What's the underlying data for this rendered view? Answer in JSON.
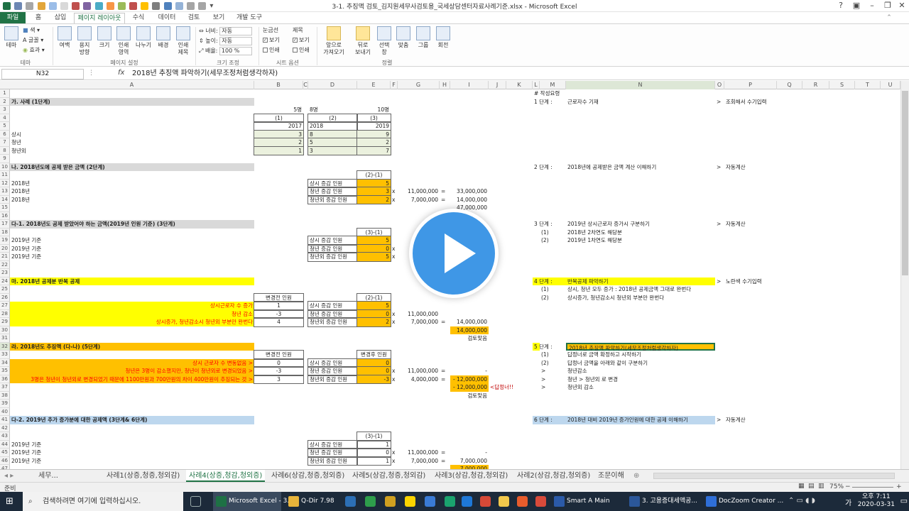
{
  "window": {
    "title": "3-1. 추징액 검토_김지원세무사검토용_국세상담센터자료사례기준.xlsx - Microsoft Excel"
  },
  "tabs": [
    {
      "label": "파일"
    },
    {
      "label": "홈"
    },
    {
      "label": "삽입"
    },
    {
      "label": "페이지 레이아웃"
    },
    {
      "label": "수식"
    },
    {
      "label": "데이터"
    },
    {
      "label": "검토"
    },
    {
      "label": "보기"
    },
    {
      "label": "개발 도구"
    }
  ],
  "ribbon": {
    "theme_group": {
      "theme": "테마",
      "colors": "색",
      "fonts": "글꼴",
      "effects": "효과",
      "label": "테마"
    },
    "page_setup": {
      "margins": "여백",
      "orientation": "용지\n방향",
      "size": "크기",
      "print_area": "인쇄\n영역",
      "breaks": "나누기",
      "background": "배경",
      "print_titles": "인쇄\n제목",
      "label": "페이지 설정"
    },
    "scale": {
      "width_label": "너비:",
      "width_value": "자동",
      "height_label": "높이:",
      "height_value": "자동",
      "scale_label": "배율:",
      "scale_value": "100 %",
      "label": "크기 조정"
    },
    "sheet_options": {
      "gridlines": "눈금선",
      "headings": "제목",
      "view1": "보기",
      "print1": "인쇄",
      "view2": "보기",
      "print2": "인쇄",
      "label": "시트 옵션"
    },
    "arrange": {
      "bring_forward": "앞으로\n가져오기",
      "send_backward": "뒤로\n보내기",
      "selection_pane": "선택\n창",
      "align": "맞춤",
      "group": "그룹",
      "rotate": "회전",
      "label": "정렬"
    }
  },
  "formula_bar": {
    "name_box": "N32",
    "fx": "fx",
    "content": "2018년 추징액 파악하기(세무조정처럼생각하자)"
  },
  "columns": [
    "A",
    "B",
    "C",
    "D",
    "E",
    "F",
    "G",
    "H",
    "I",
    "J",
    "K",
    "L",
    "M",
    "N",
    "O",
    "P",
    "Q",
    "R",
    "S",
    "T",
    "U"
  ],
  "rows": [
    "1",
    "2",
    "3",
    "4",
    "5",
    "6",
    "7",
    "8",
    "9",
    "10",
    "11",
    "12",
    "13",
    "14",
    "15",
    "16",
    "17",
    "18",
    "19",
    "20",
    "21",
    "22",
    "23",
    "24",
    "25",
    "26",
    "27",
    "28",
    "29",
    "30",
    "31",
    "32",
    "33",
    "34",
    "35",
    "36",
    "37",
    "38",
    "39",
    "40",
    "41",
    "42",
    "43",
    "44",
    "45",
    "46",
    "47"
  ],
  "cells": {
    "A2": "가. 사례 (1단계)",
    "B3": "5명",
    "D3": "8명",
    "E3": "10명",
    "B4": "(1)",
    "D4": "(2)",
    "E4": "(3)",
    "B5": "2017",
    "D5": "2018",
    "E5": "2019",
    "A6": "상시",
    "B6": "3",
    "D6": "8",
    "E6": "9",
    "A7": "청년",
    "B7": "2",
    "D7": "5",
    "E7": "2",
    "A8": "청년외",
    "B8": "1",
    "D8": "3",
    "E8": "7",
    "A10": "나. 2018년도에 공제 받은 금액 (2단계)",
    "E11": "(2)-(1)",
    "A12": "2018년",
    "D12": "상시 증감 인원",
    "E12": "5",
    "A13": "2018년",
    "D13": "청년 증감 인원",
    "E13": "3",
    "F13": "x",
    "G13": "11,000,000",
    "H13": "=",
    "I13": "33,000,000",
    "A14": "2018년",
    "D14": "청년외 증감 인원",
    "E14": "2",
    "F14": "x",
    "G14": "7,000,000",
    "H14": "=",
    "I14": "14,000,000",
    "I15": "47,000,000",
    "A17": "다-1. 2018년도 공제 받았어야 하는 금액(2019년 인원 기준) (3단계)",
    "E18": "(3)-(1)",
    "A19": "2019년 기준",
    "D19": "상시 증감 인원",
    "E19": "5",
    "A20": "2019년 기준",
    "D20": "청년 증감 인원",
    "E20": "0",
    "F20": "x",
    "A21": "2019년 기준",
    "D21": "청년외 증감 인원",
    "E21": "5",
    "F21": "x",
    "A24": "마. 2018년 공제분 반복 공제",
    "B26": "변경전 인원",
    "E26": "(2)-(1)",
    "A27": "상시근로자 수 증가",
    "B27": "1",
    "D27": "상시 증감 인원",
    "E27": "5",
    "A28": "청년 감소",
    "B28": "-3",
    "D28": "청년 증감 인원",
    "E28": "0",
    "F28": "x",
    "G28": "11,000,000",
    "A29": "상시증가, 청년감소시 청년외 부분만 완번다",
    "B29": "4",
    "D29": "청년외 증감 인원",
    "E29": "2",
    "F29": "x",
    "G29": "7,000,000",
    "H29": "=",
    "I29": "14,000,000",
    "I30": "14,000,000",
    "I31": "검토맞음",
    "A32": "라. 2018년도 추징액 (다-나) (5단계)",
    "B33": "변경전 인원",
    "E33": "변경후 인원",
    "A34": "상시 근로자 수 변동없음 >",
    "B34": "0",
    "D34": "상시 증감 인원",
    "E34": "0",
    "A35": "청년은 3명이 감소했지만, 청년이 청년외로 변경되었음 >",
    "B35": "-3",
    "D35": "청년 증감 인원",
    "E35": "0",
    "F35": "x",
    "G35": "11,000,000",
    "H35": "=",
    "I35": "-",
    "A36": "3명은 청년이 청년외로 변경되었기 때문에 1100만원과 700만원의 차이 400만원이 추징되는 것 >",
    "B36": "3",
    "D36": "청년외 증감 인원",
    "E36": "-3",
    "F36": "x",
    "G36": "4,000,000",
    "H36": "=",
    "I36": "- 12,000,000",
    "I37": "- 12,000,000",
    "J37": "<답정너!!",
    "I38": "검토맞음",
    "A41": "다-2. 2019년 추가 증가분에 대한 공제액 (3단계& 6단계)",
    "E43": "(3)-(1)",
    "A44": "2019년 기준",
    "D44": "상시 증감 인원",
    "E44": "1",
    "A45": "2019년 기준",
    "D45": "청년 증감 인원",
    "E45": "0",
    "F45": "x",
    "G45": "11,000,000",
    "H45": "=",
    "I45": "-",
    "A46": "2019년 기준",
    "D46": "청년외 증감 인원",
    "E46": "1",
    "F46": "x",
    "G46": "7,000,000",
    "H46": "=",
    "I46": "7,000,000",
    "I47": "7,000,000",
    "L1": "# 작성요령",
    "L2": "1 단계 :",
    "N2": "근로자수 기재",
    "O2": ">",
    "P2": "조회해서 수기입력",
    "L10": "2 단계 :",
    "N10": "2018년에 공제받은 금액 계산 이해하기",
    "O10": ">",
    "P10": "자동계산",
    "L17": "3 단계 :",
    "N17": "2019년 상시근로자 증가시 구분하기",
    "O17": ">",
    "P17": "자동계산",
    "M18": "(1)",
    "N18": "2018년 2차연도 해당분",
    "M19": "(2)",
    "N19": "2019년 1차연도 해당분",
    "L24": "4 단계 :",
    "N24": "반복공제 파악하기",
    "O24": ">",
    "P24": "노란색 수기입력",
    "M25": "(1)",
    "N25": "상시, 청년 모두 증가 : 2018년 공제금액 그대로 완번다",
    "M26": "(2)",
    "N26": "상시증가, 청년감소시 청년외 부분만 완번다",
    "L32": "5 단계 :",
    "N32": "2018년 추징액 파악하기(세무조정처럼생각하자)",
    "M33": "(1)",
    "N33": "답정너로 금액 확정하고 시작하기",
    "M34": "(2)",
    "N34": "답정너 금액을 아래와 같이 구분하기",
    "M35": ">",
    "N35": "청년감소",
    "M36": ">",
    "N36": "청년 > 청년외 로 변경",
    "M37": ">",
    "N37": "청년외 감소",
    "L41": "6 단계 :",
    "N41": "2018년 대비 2019년 증가인원에 대한 공제 이해하기",
    "O41": ">",
    "P41": "자동계산"
  },
  "sheet_tabs": [
    {
      "label": "세무..."
    },
    {
      "label": "사례1(상증,청증,청외감)"
    },
    {
      "label": "사례4(상증,청감,청외증)"
    },
    {
      "label": "사례6(상감,청증,청외증)"
    },
    {
      "label": "사례5(상감,청증,청외감)"
    },
    {
      "label": "사례3(상감,청감,청외감)"
    },
    {
      "label": "사례2(상감,청감,청외증)"
    },
    {
      "label": "조문이해"
    }
  ],
  "status": {
    "ready": "준비",
    "zoom": "75%"
  },
  "taskbar": {
    "search_placeholder": "검색하려면 여기에 입력하십시오.",
    "apps": [
      {
        "label": "Microsoft Excel - 3..."
      },
      {
        "label": "Q-Dir 7.98"
      },
      {
        "label": "Smart A Main"
      },
      {
        "label": "3. 고용증대세액공..."
      },
      {
        "label": "DocZoom Creator ..."
      }
    ],
    "time": "오후 7:11",
    "date": "2020-03-31",
    "ime": "가"
  },
  "colors": {
    "excel_green": "#217346",
    "yellow_fill": "#ffff00",
    "orange_fill": "#ffc000",
    "light_green_fill": "#ebf1de",
    "blue_fill": "#bdd7ee",
    "gray_fill": "#d9d9d9",
    "red_text": "#ff0000",
    "play_button": "#3f97e6"
  }
}
